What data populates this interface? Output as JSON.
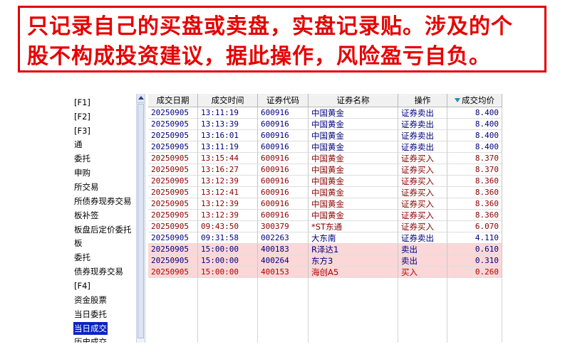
{
  "banner": {
    "line1": "只记录自己的买盘或卖盘，实盘记录贴。涉及的个",
    "line2": "股不构成投资建议，据此操作，风险盈亏自负。",
    "color": "#e60000"
  },
  "sidebar": {
    "items": [
      {
        "label": "[F1]"
      },
      {
        "label": "[F2]"
      },
      {
        "label": "[F3]"
      },
      {
        "label": "通"
      },
      {
        "label": "委托"
      },
      {
        "label": "申购"
      },
      {
        "label": "所交易"
      },
      {
        "label": "所债券现券交易"
      },
      {
        "label": "板补签"
      },
      {
        "label": "板盘后定价委托"
      },
      {
        "label": "板"
      },
      {
        "label": "委托"
      },
      {
        "label": "债券现券交易"
      },
      {
        "label": "[F4]"
      },
      {
        "label": "资金股票"
      },
      {
        "label": "当日委托"
      },
      {
        "label": "当日成交",
        "selected": true
      },
      {
        "label": "历史成交"
      }
    ]
  },
  "table": {
    "columns": [
      "成交日期",
      "成交时间",
      "证券代码",
      "证券名称",
      "操作",
      "成交均价"
    ],
    "sort_icon": "sort-desc-icon",
    "rows": [
      {
        "date": "20250905",
        "time": "13:11:19",
        "code": "600916",
        "name": "中国黄金",
        "op": "证券卖出",
        "price": "8.400",
        "side": "sell",
        "hl": false
      },
      {
        "date": "20250905",
        "time": "13:13:39",
        "code": "600916",
        "name": "中国黄金",
        "op": "证券卖出",
        "price": "8.400",
        "side": "sell",
        "hl": false
      },
      {
        "date": "20250905",
        "time": "13:16:01",
        "code": "600916",
        "name": "中国黄金",
        "op": "证券卖出",
        "price": "8.400",
        "side": "sell",
        "hl": false
      },
      {
        "date": "20250905",
        "time": "13:11:19",
        "code": "600916",
        "name": "中国黄金",
        "op": "证券卖出",
        "price": "8.400",
        "side": "sell",
        "hl": false
      },
      {
        "date": "20250905",
        "time": "13:15:44",
        "code": "600916",
        "name": "中国黄金",
        "op": "证券买入",
        "price": "8.370",
        "side": "buy",
        "hl": false
      },
      {
        "date": "20250905",
        "time": "13:16:27",
        "code": "600916",
        "name": "中国黄金",
        "op": "证券买入",
        "price": "8.370",
        "side": "buy",
        "hl": false
      },
      {
        "date": "20250905",
        "time": "13:12:39",
        "code": "600916",
        "name": "中国黄金",
        "op": "证券买入",
        "price": "8.360",
        "side": "buy",
        "hl": false
      },
      {
        "date": "20250905",
        "time": "13:12:41",
        "code": "600916",
        "name": "中国黄金",
        "op": "证券买入",
        "price": "8.360",
        "side": "buy",
        "hl": false
      },
      {
        "date": "20250905",
        "time": "13:12:39",
        "code": "600916",
        "name": "中国黄金",
        "op": "证券买入",
        "price": "8.360",
        "side": "buy",
        "hl": false
      },
      {
        "date": "20250905",
        "time": "13:12:39",
        "code": "600916",
        "name": "中国黄金",
        "op": "证券买入",
        "price": "8.360",
        "side": "buy",
        "hl": false
      },
      {
        "date": "20250905",
        "time": "09:43:50",
        "code": "300379",
        "name": "*ST东通",
        "op": "证券买入",
        "price": "6.070",
        "side": "buy",
        "hl": false
      },
      {
        "date": "20250905",
        "time": "09:31:58",
        "code": "002263",
        "name": "大东南",
        "op": "证券卖出",
        "price": "4.110",
        "side": "sell",
        "hl": false
      },
      {
        "date": "20250905",
        "time": "15:00:00",
        "code": "400183",
        "name": "R泽达1",
        "op": "卖出",
        "price": "0.610",
        "side": "sell",
        "hl": true
      },
      {
        "date": "20250905",
        "time": "15:00:00",
        "code": "400264",
        "name": "东方3",
        "op": "卖出",
        "price": "0.310",
        "side": "sell",
        "hl": true
      },
      {
        "date": "20250905",
        "time": "15:00:00",
        "code": "400153",
        "name": "海创A5",
        "op": "买入",
        "price": "0.260",
        "side": "buy",
        "hl": true
      }
    ]
  }
}
